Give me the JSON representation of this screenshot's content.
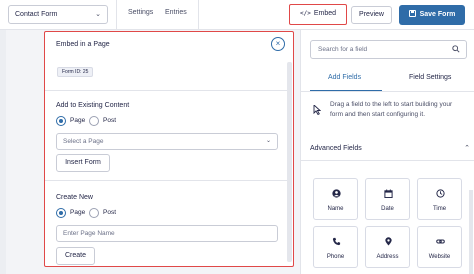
{
  "toolbar": {
    "form_selector": "Contact Form",
    "settings_link": "Settings",
    "entries_link": "Entries",
    "embed_button": "Embed",
    "embed_code_glyph": "</>",
    "preview_button": "Preview",
    "save_button": "Save Form"
  },
  "embed_panel": {
    "title": "Embed in a Page",
    "form_id_badge": "Form ID: 25",
    "existing": {
      "heading": "Add to Existing Content",
      "radio_page": "Page",
      "radio_post": "Post",
      "select_placeholder": "Select a Page",
      "insert_button": "Insert Form"
    },
    "create_new": {
      "heading": "Create New",
      "radio_page": "Page",
      "radio_post": "Post",
      "input_placeholder": "Enter Page Name",
      "create_button": "Create"
    }
  },
  "sidebar": {
    "search_placeholder": "Search for a field",
    "tabs": [
      {
        "label": "Add Fields"
      },
      {
        "label": "Field Settings"
      }
    ],
    "hint": "Drag a field to the left to start building your form and then start configuring it.",
    "section_title": "Advanced Fields",
    "fields": [
      {
        "label": "Name",
        "icon": "person-icon"
      },
      {
        "label": "Date",
        "icon": "calendar-icon"
      },
      {
        "label": "Time",
        "icon": "clock-icon"
      },
      {
        "label": "Phone",
        "icon": "phone-icon"
      },
      {
        "label": "Address",
        "icon": "map-pin-icon"
      },
      {
        "label": "Website",
        "icon": "link-icon"
      }
    ]
  },
  "colors": {
    "accent_blue": "#2f6ca8",
    "highlight_red": "#e04848",
    "text_dark": "#242748"
  }
}
